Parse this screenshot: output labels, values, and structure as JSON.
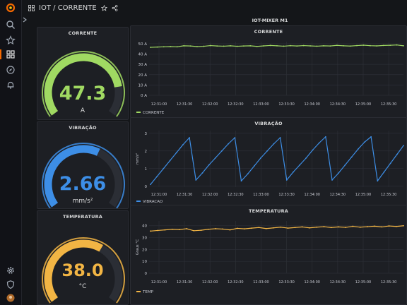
{
  "breadcrumb": {
    "folder": "IOT",
    "separator": "/",
    "dashboard": "CORRENTE"
  },
  "row_title": "IOT-MIXER M1",
  "icons": {
    "logo": "grafana-logo-icon",
    "search": "search-icon",
    "starred": "star-icon",
    "dashboards": "grid-icon",
    "explore": "compass-icon",
    "alerting": "bell-icon",
    "settings": "gear-icon",
    "admin": "shield-icon",
    "user": "avatar-icon",
    "star_dashboard": "star-icon",
    "share": "share-icon",
    "expand": "chevron-right-icon"
  },
  "gauges": [
    {
      "title": "CORRENTE",
      "value": "47.3",
      "unit": "A",
      "fraction": 0.82,
      "color": "#a0d962"
    },
    {
      "title": "VIBRAÇÃO",
      "value": "2.66",
      "unit": "mm/s²",
      "fraction": 0.6,
      "color": "#3d8ee6"
    },
    {
      "title": "TEMPERATURA",
      "value": "38.0",
      "unit": "°C",
      "fraction": 0.62,
      "color": "#f2b544"
    }
  ],
  "chart_data": [
    {
      "type": "line",
      "title": "CORRENTE",
      "ylabel": "",
      "yticks": [
        "0 A",
        "10 A",
        "20 A",
        "30 A",
        "40 A",
        "50 A"
      ],
      "ylim": [
        0,
        52
      ],
      "xticks": [
        "12:31:00",
        "12:31:30",
        "12:32:00",
        "12:32:30",
        "12:33:00",
        "12:33:30",
        "12:34:00",
        "12:34:30",
        "12:35:00",
        "12:35:30"
      ],
      "grid": true,
      "legend_position": "bottom-left",
      "series": [
        {
          "name": "CORRENTE",
          "color": "#a0d962",
          "values": [
            46.5,
            46.8,
            47.0,
            47.2,
            47.0,
            48.0,
            47.8,
            47.2,
            47.5,
            48.2,
            47.8,
            47.6,
            48.0,
            47.5,
            47.8,
            48.0,
            47.4,
            47.9,
            48.3,
            48.0,
            47.6,
            48.1,
            47.8,
            48.2,
            47.9,
            47.6,
            48.0,
            47.8,
            48.4,
            48.0,
            47.7,
            48.2,
            48.6,
            48.1,
            47.9,
            48.3,
            48.5,
            48.8,
            48.0
          ]
        }
      ]
    },
    {
      "type": "line",
      "title": "VIBRAÇÃO",
      "ylabel": "mm/s²",
      "yticks": [
        "0",
        "1",
        "2",
        "3"
      ],
      "ylim": [
        -0.05,
        3.15
      ],
      "xticks": [
        "12:31:00",
        "12:31:30",
        "12:32:00",
        "12:32:30",
        "12:33:00",
        "12:33:30",
        "12:34:00",
        "12:34:30",
        "12:35:00",
        "12:35:30"
      ],
      "grid": true,
      "legend_position": "bottom-left",
      "series": [
        {
          "name": "VIBRACAO",
          "color": "#3d8ee6",
          "values": [
            0.1,
            0.55,
            1.0,
            1.45,
            1.9,
            2.35,
            2.75,
            0.35,
            0.75,
            1.2,
            1.6,
            2.0,
            2.4,
            2.75,
            0.3,
            0.7,
            1.15,
            1.6,
            2.0,
            2.4,
            2.75,
            0.35,
            0.8,
            1.2,
            1.6,
            2.05,
            2.45,
            2.8,
            0.35,
            0.75,
            1.2,
            1.65,
            2.1,
            2.5,
            2.8,
            0.3,
            0.8,
            1.3,
            1.8,
            2.3
          ]
        }
      ]
    },
    {
      "type": "line",
      "title": "TEMPERATURA",
      "ylabel": "Graus °C",
      "yticks": [
        "0",
        "10",
        "20",
        "30",
        "40"
      ],
      "ylim": [
        0,
        44
      ],
      "xticks": [
        "12:31:00",
        "12:31:30",
        "12:32:00",
        "12:32:30",
        "12:33:00",
        "12:33:30",
        "12:34:00",
        "12:34:30",
        "12:35:00",
        "12:35:30"
      ],
      "grid": true,
      "legend_position": "bottom-left",
      "series": [
        {
          "name": "TEMP",
          "color": "#f2b544",
          "values": [
            35.5,
            36.0,
            36.5,
            37.0,
            36.8,
            37.5,
            35.8,
            36.2,
            37.0,
            37.5,
            37.2,
            36.5,
            37.8,
            37.4,
            38.0,
            38.5,
            37.6,
            38.2,
            38.8,
            38.0,
            38.5,
            39.0,
            38.2,
            38.8,
            39.2,
            38.5,
            39.0,
            38.6,
            39.5,
            38.8,
            39.2,
            39.6,
            39.0,
            39.8,
            39.4,
            40.0
          ]
        }
      ]
    }
  ]
}
